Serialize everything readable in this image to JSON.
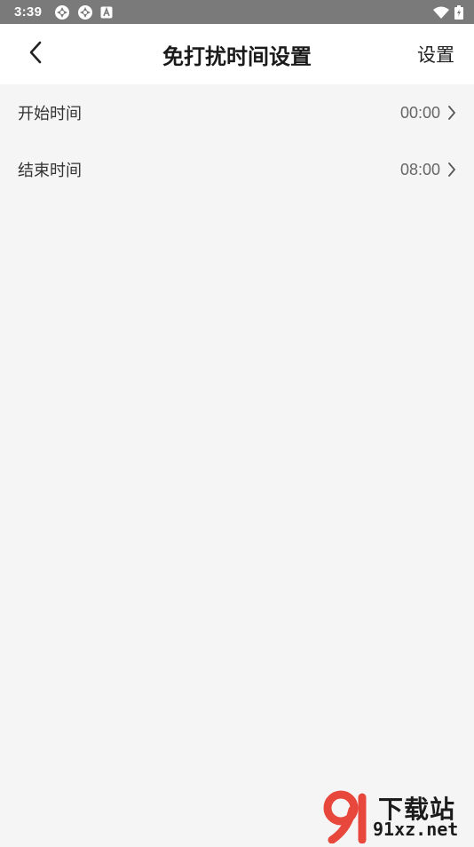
{
  "status_bar": {
    "time": "3:39",
    "icons_left": [
      "settings-gear-icon",
      "settings-gear-icon",
      "font-a-icon"
    ],
    "icons_right": [
      "wifi-icon",
      "battery-charging-icon"
    ]
  },
  "header": {
    "back_icon": "chevron-left-icon",
    "title": "免打扰时间设置",
    "action_label": "设置"
  },
  "rows": [
    {
      "label": "开始时间",
      "value": "00:00"
    },
    {
      "label": "结束时间",
      "value": "08:00"
    }
  ],
  "watermark": {
    "line1": "下载站",
    "line2": "91xz.net",
    "brand_color": "#e8473b"
  },
  "colors": {
    "status_bar_bg": "#7a7a7a",
    "page_bg": "#f5f5f5",
    "header_bg": "#ffffff"
  }
}
